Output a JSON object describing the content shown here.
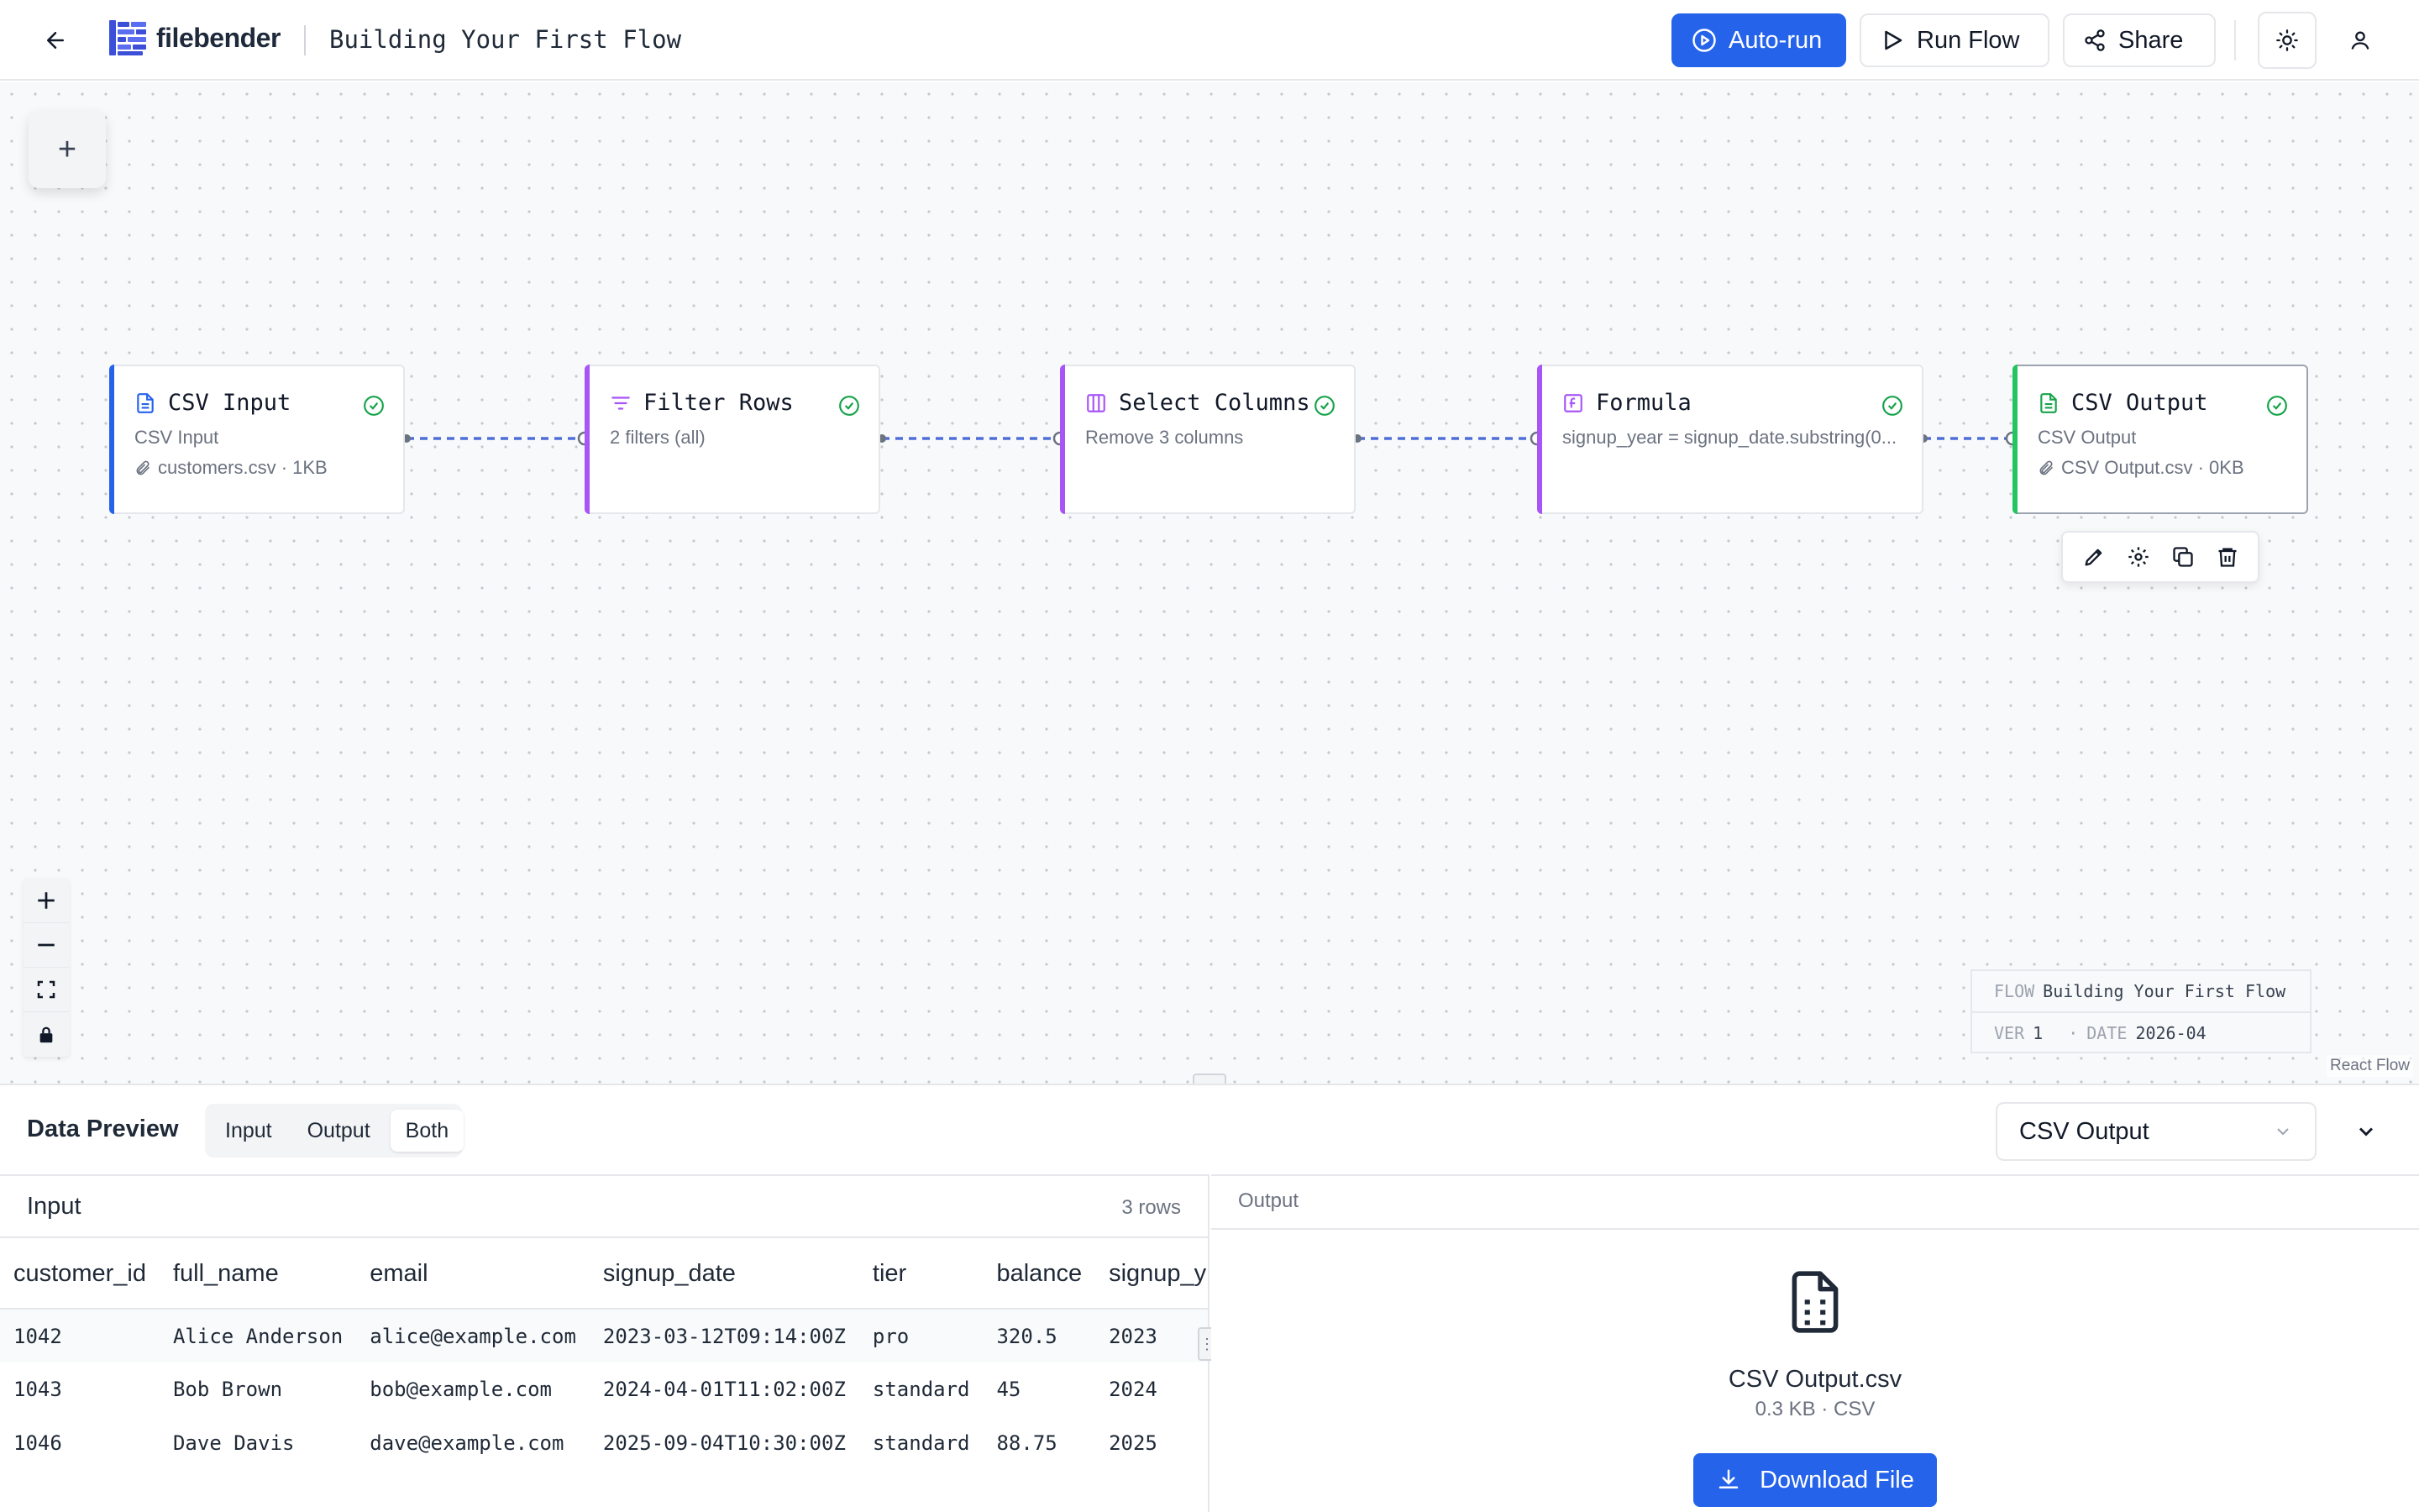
{
  "header": {
    "logo_text": "filebender",
    "flow_title": "Building Your First Flow",
    "autorun_label": "Auto-run",
    "run_label": "Run Flow",
    "share_label": "Share",
    "accent_color": "#2563eb"
  },
  "canvas": {
    "add_label": "+",
    "nodes": [
      {
        "title": "CSV Input",
        "subtitle": "CSV Input",
        "file": "customers.csv · 1KB",
        "color": "#2563eb",
        "icon": "file-text-icon",
        "status": "success"
      },
      {
        "title": "Filter Rows",
        "subtitle": "2 filters (all)",
        "file": "",
        "color": "#a855f7",
        "icon": "filter-icon",
        "status": "success"
      },
      {
        "title": "Select Columns",
        "subtitle": "Remove 3 columns",
        "file": "",
        "color": "#a855f7",
        "icon": "columns-icon",
        "status": "success"
      },
      {
        "title": "Formula",
        "subtitle": "signup_year = signup_date.substring(0...",
        "file": "",
        "color": "#a855f7",
        "icon": "function-icon",
        "status": "success"
      },
      {
        "title": "CSV Output",
        "subtitle": "CSV Output",
        "file": "CSV Output.csv · 0KB",
        "color": "#22c55e",
        "icon": "file-output-icon",
        "status": "success"
      }
    ],
    "node_toolbar": [
      "edit-icon",
      "gear-icon",
      "copy-icon",
      "trash-icon"
    ],
    "zoom_controls": [
      "zoom-in-icon",
      "zoom-out-icon",
      "fit-view-icon",
      "lock-icon"
    ],
    "meta": {
      "flow_key": "FLOW",
      "flow_value": "Building Your First Flow",
      "ver_key": "VER",
      "ver_value": "1",
      "date_key": "DATE",
      "date_value": "2026-04"
    },
    "attribution": "React Flow"
  },
  "preview": {
    "title": "Data Preview",
    "modes": [
      "Input",
      "Output",
      "Both"
    ],
    "active_mode": "Both",
    "selected_node": "CSV Output",
    "input": {
      "title": "Input",
      "rows_label": "3 rows",
      "columns": [
        "customer_id",
        "full_name",
        "email",
        "signup_date",
        "tier",
        "balance",
        "signup_y"
      ],
      "rows": [
        [
          "1042",
          "Alice Anderson",
          "alice@example.com",
          "2023-03-12T09:14:00Z",
          "pro",
          "320.5",
          "2023"
        ],
        [
          "1043",
          "Bob Brown",
          "bob@example.com",
          "2024-04-01T11:02:00Z",
          "standard",
          "45",
          "2024"
        ],
        [
          "1046",
          "Dave Davis",
          "dave@example.com",
          "2025-09-04T10:30:00Z",
          "standard",
          "88.75",
          "2025"
        ]
      ]
    },
    "output": {
      "title": "Output",
      "file_name": "CSV Output.csv",
      "file_meta": "0.3 KB · CSV",
      "download_label": "Download File"
    }
  }
}
